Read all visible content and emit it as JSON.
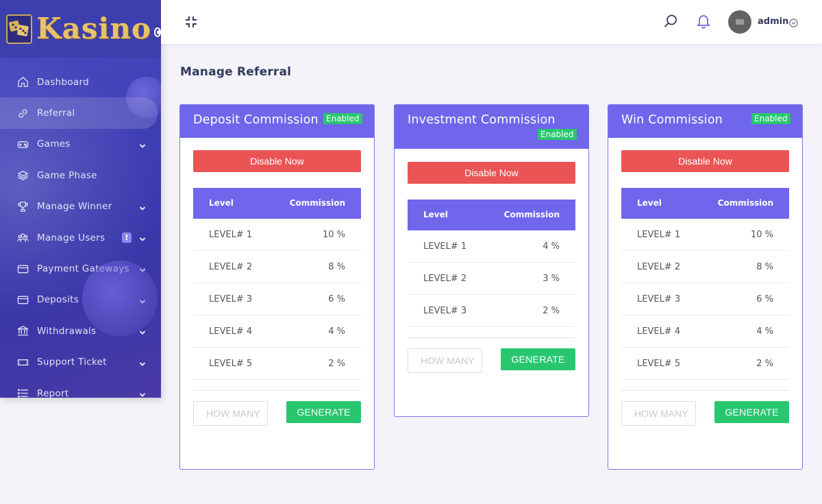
{
  "brand": {
    "name": "Kasino"
  },
  "sidebar": {
    "items": [
      {
        "label": "Dashboard",
        "icon": "home-icon",
        "active": false,
        "has_submenu": false
      },
      {
        "label": "Referral",
        "icon": "link-icon",
        "active": true,
        "has_submenu": false
      },
      {
        "label": "Games",
        "icon": "gamepad-icon",
        "active": false,
        "has_submenu": true
      },
      {
        "label": "Game Phase",
        "icon": "layers-icon",
        "active": false,
        "has_submenu": false
      },
      {
        "label": "Manage Winner",
        "icon": "trophy-icon",
        "active": false,
        "has_submenu": true
      },
      {
        "label": "Manage Users",
        "icon": "users-icon",
        "active": false,
        "has_submenu": true,
        "alert": "!"
      },
      {
        "label": "Payment Gateways",
        "icon": "credit-card-icon",
        "active": false,
        "has_submenu": true
      },
      {
        "label": "Deposits",
        "icon": "credit-card-icon",
        "active": false,
        "has_submenu": true
      },
      {
        "label": "Withdrawals",
        "icon": "bank-icon",
        "active": false,
        "has_submenu": true
      },
      {
        "label": "Support Ticket",
        "icon": "ticket-icon",
        "active": false,
        "has_submenu": true
      },
      {
        "label": "Report",
        "icon": "list-icon",
        "active": false,
        "has_submenu": true
      }
    ]
  },
  "topbar": {
    "user": "admin"
  },
  "page": {
    "title": "Manage Referral"
  },
  "cards": [
    {
      "title": "Deposit Commission",
      "status": "Enabled",
      "disable_label": "Disable Now",
      "col_level": "Level",
      "col_commission": "Commission",
      "rows": [
        {
          "level": "LEVEL# 1",
          "commission": "10 %"
        },
        {
          "level": "LEVEL# 2",
          "commission": "8 %"
        },
        {
          "level": "LEVEL# 3",
          "commission": "6 %"
        },
        {
          "level": "LEVEL# 4",
          "commission": "4 %"
        },
        {
          "level": "LEVEL# 5",
          "commission": "2 %"
        }
      ],
      "input_placeholder": "HOW MANY",
      "generate_label": "GENERATE"
    },
    {
      "title": "Investment Commission",
      "status": "Enabled",
      "disable_label": "Disable Now",
      "col_level": "Level",
      "col_commission": "Commission",
      "rows": [
        {
          "level": "LEVEL# 1",
          "commission": "4 %"
        },
        {
          "level": "LEVEL# 2",
          "commission": "3 %"
        },
        {
          "level": "LEVEL# 3",
          "commission": "2 %"
        }
      ],
      "input_placeholder": "HOW MANY",
      "generate_label": "GENERATE"
    },
    {
      "title": "Win Commission",
      "status": "Enabled",
      "disable_label": "Disable Now",
      "col_level": "Level",
      "col_commission": "Commission",
      "rows": [
        {
          "level": "LEVEL# 1",
          "commission": "10 %"
        },
        {
          "level": "LEVEL# 2",
          "commission": "8 %"
        },
        {
          "level": "LEVEL# 3",
          "commission": "6 %"
        },
        {
          "level": "LEVEL# 4",
          "commission": "4 %"
        },
        {
          "level": "LEVEL# 5",
          "commission": "2 %"
        }
      ],
      "input_placeholder": "HOW MANY",
      "generate_label": "GENERATE"
    }
  ],
  "colors": {
    "primary": "#6f66eb",
    "danger": "#ea5455",
    "success": "#28c76f",
    "sidebar": "#3f3fb5"
  }
}
